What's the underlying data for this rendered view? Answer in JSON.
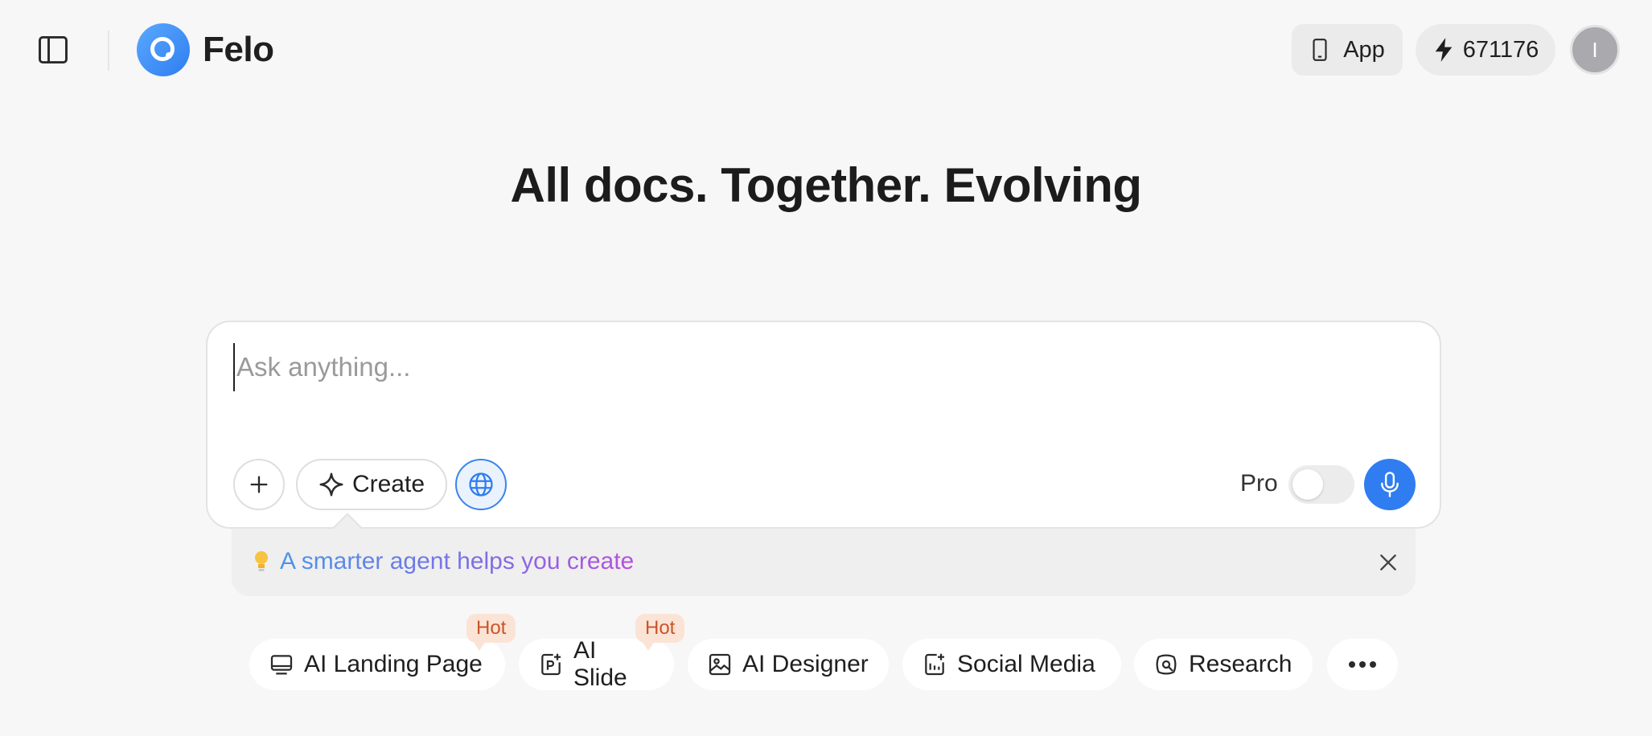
{
  "header": {
    "brand": "Felo",
    "app_label": "App",
    "credits": "671176",
    "avatar_initial": "I"
  },
  "hero": {
    "headline": "All docs. Together. Evolving"
  },
  "composer": {
    "placeholder": "Ask anything...",
    "value": "",
    "create_label": "Create",
    "pro_label": "Pro",
    "pro_enabled": false,
    "accent_color": "#2f7df0"
  },
  "tip": {
    "text": "A smarter agent helps you create"
  },
  "quick_actions": [
    {
      "label": "AI Landing Page",
      "icon": "monitor-icon",
      "badge": "Hot"
    },
    {
      "label": "AI Slide",
      "icon": "slide-icon",
      "badge": "Hot"
    },
    {
      "label": "AI Designer",
      "icon": "image-icon"
    },
    {
      "label": "Social Media",
      "icon": "social-doc-icon"
    },
    {
      "label": "Research",
      "icon": "research-icon"
    }
  ],
  "colors": {
    "hot_badge_bg": "#fbe4d6",
    "hot_badge_text": "#c8552a",
    "logo": "#3a8af3"
  }
}
